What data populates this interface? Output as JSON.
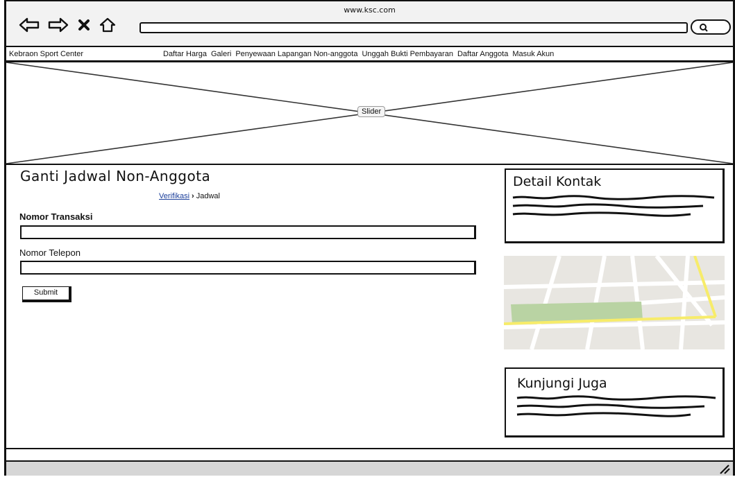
{
  "browser": {
    "url": "www.ksc.com"
  },
  "menubar": {
    "brand": "Kebraon Sport Center",
    "items": [
      "Daftar Harga",
      "Galeri",
      "Penyewaan Lapangan Non-anggota",
      "Unggah Bukti Pembayaran",
      "Daftar Anggota",
      "Masuk Akun"
    ]
  },
  "slider": {
    "label": "Slider"
  },
  "main": {
    "title": "Ganti Jadwal Non-Anggota",
    "breadcrumb": {
      "link": "Verifikasi",
      "current": "Jadwal"
    },
    "fields": [
      {
        "label": "Nomor Transaksi",
        "value": ""
      },
      {
        "label": "Nomor Telepon",
        "value": ""
      }
    ],
    "submit_label": "Submit"
  },
  "sidebar": {
    "contact_title": "Detail Kontak",
    "visit_title": "Kunjungi Juga"
  },
  "icons": {
    "back": "arrow-left-icon",
    "forward": "arrow-right-icon",
    "stop": "close-icon",
    "home": "home-icon",
    "search": "search-icon",
    "resize": "resize-grip-icon"
  },
  "colors": {
    "link": "#1a3e9a",
    "map_bg": "#e8e6e1",
    "map_park": "#b9d3a3",
    "map_road_major": "#f7ec6a",
    "status_bar": "#d6d6d6"
  }
}
